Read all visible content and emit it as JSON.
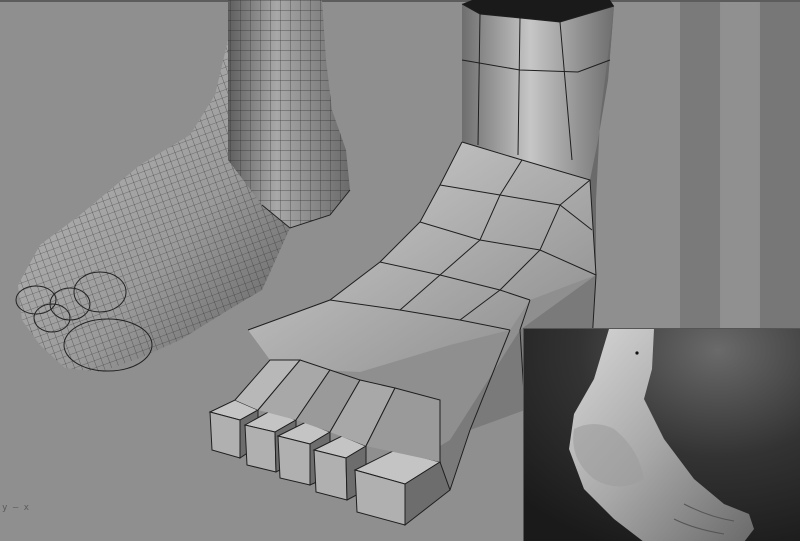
{
  "viewport": {
    "axis_label": "y — x",
    "background_color": "#8f8f8f",
    "wire_color": "#1f1f1f"
  },
  "models": [
    {
      "name": "detailed-foot-mesh"
    },
    {
      "name": "lowpoly-foot-mesh"
    }
  ],
  "reference": {
    "panel": "sculpt-reference-render"
  }
}
